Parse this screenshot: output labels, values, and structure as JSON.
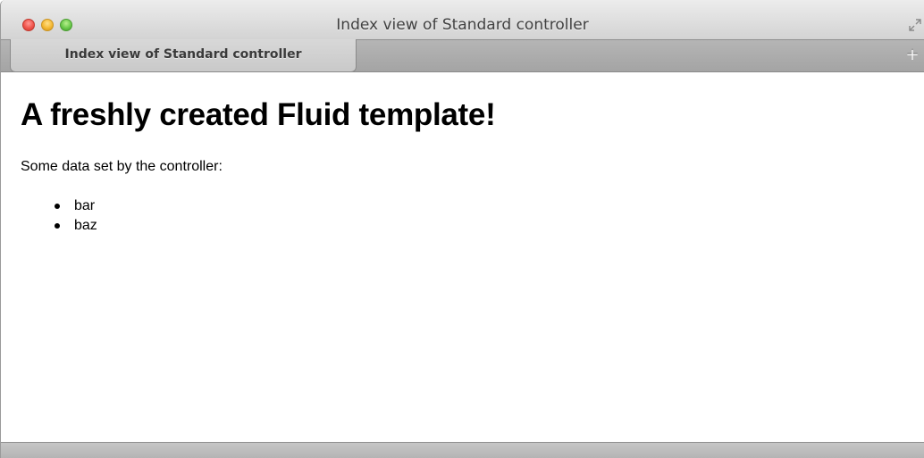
{
  "window": {
    "title": "Index view of Standard controller",
    "tabs": [
      {
        "label": "Index view of Standard controller",
        "active": true
      }
    ],
    "new_tab_label": "+"
  },
  "page": {
    "heading": "A freshly created Fluid template!",
    "intro": "Some data set by the controller:",
    "items": [
      "bar",
      "baz"
    ]
  },
  "colors": {
    "close": "#f0544b",
    "minimize": "#f4b832",
    "maximize": "#6ac94a"
  },
  "icons": {
    "fullscreen": "fullscreen-arrows-icon"
  }
}
